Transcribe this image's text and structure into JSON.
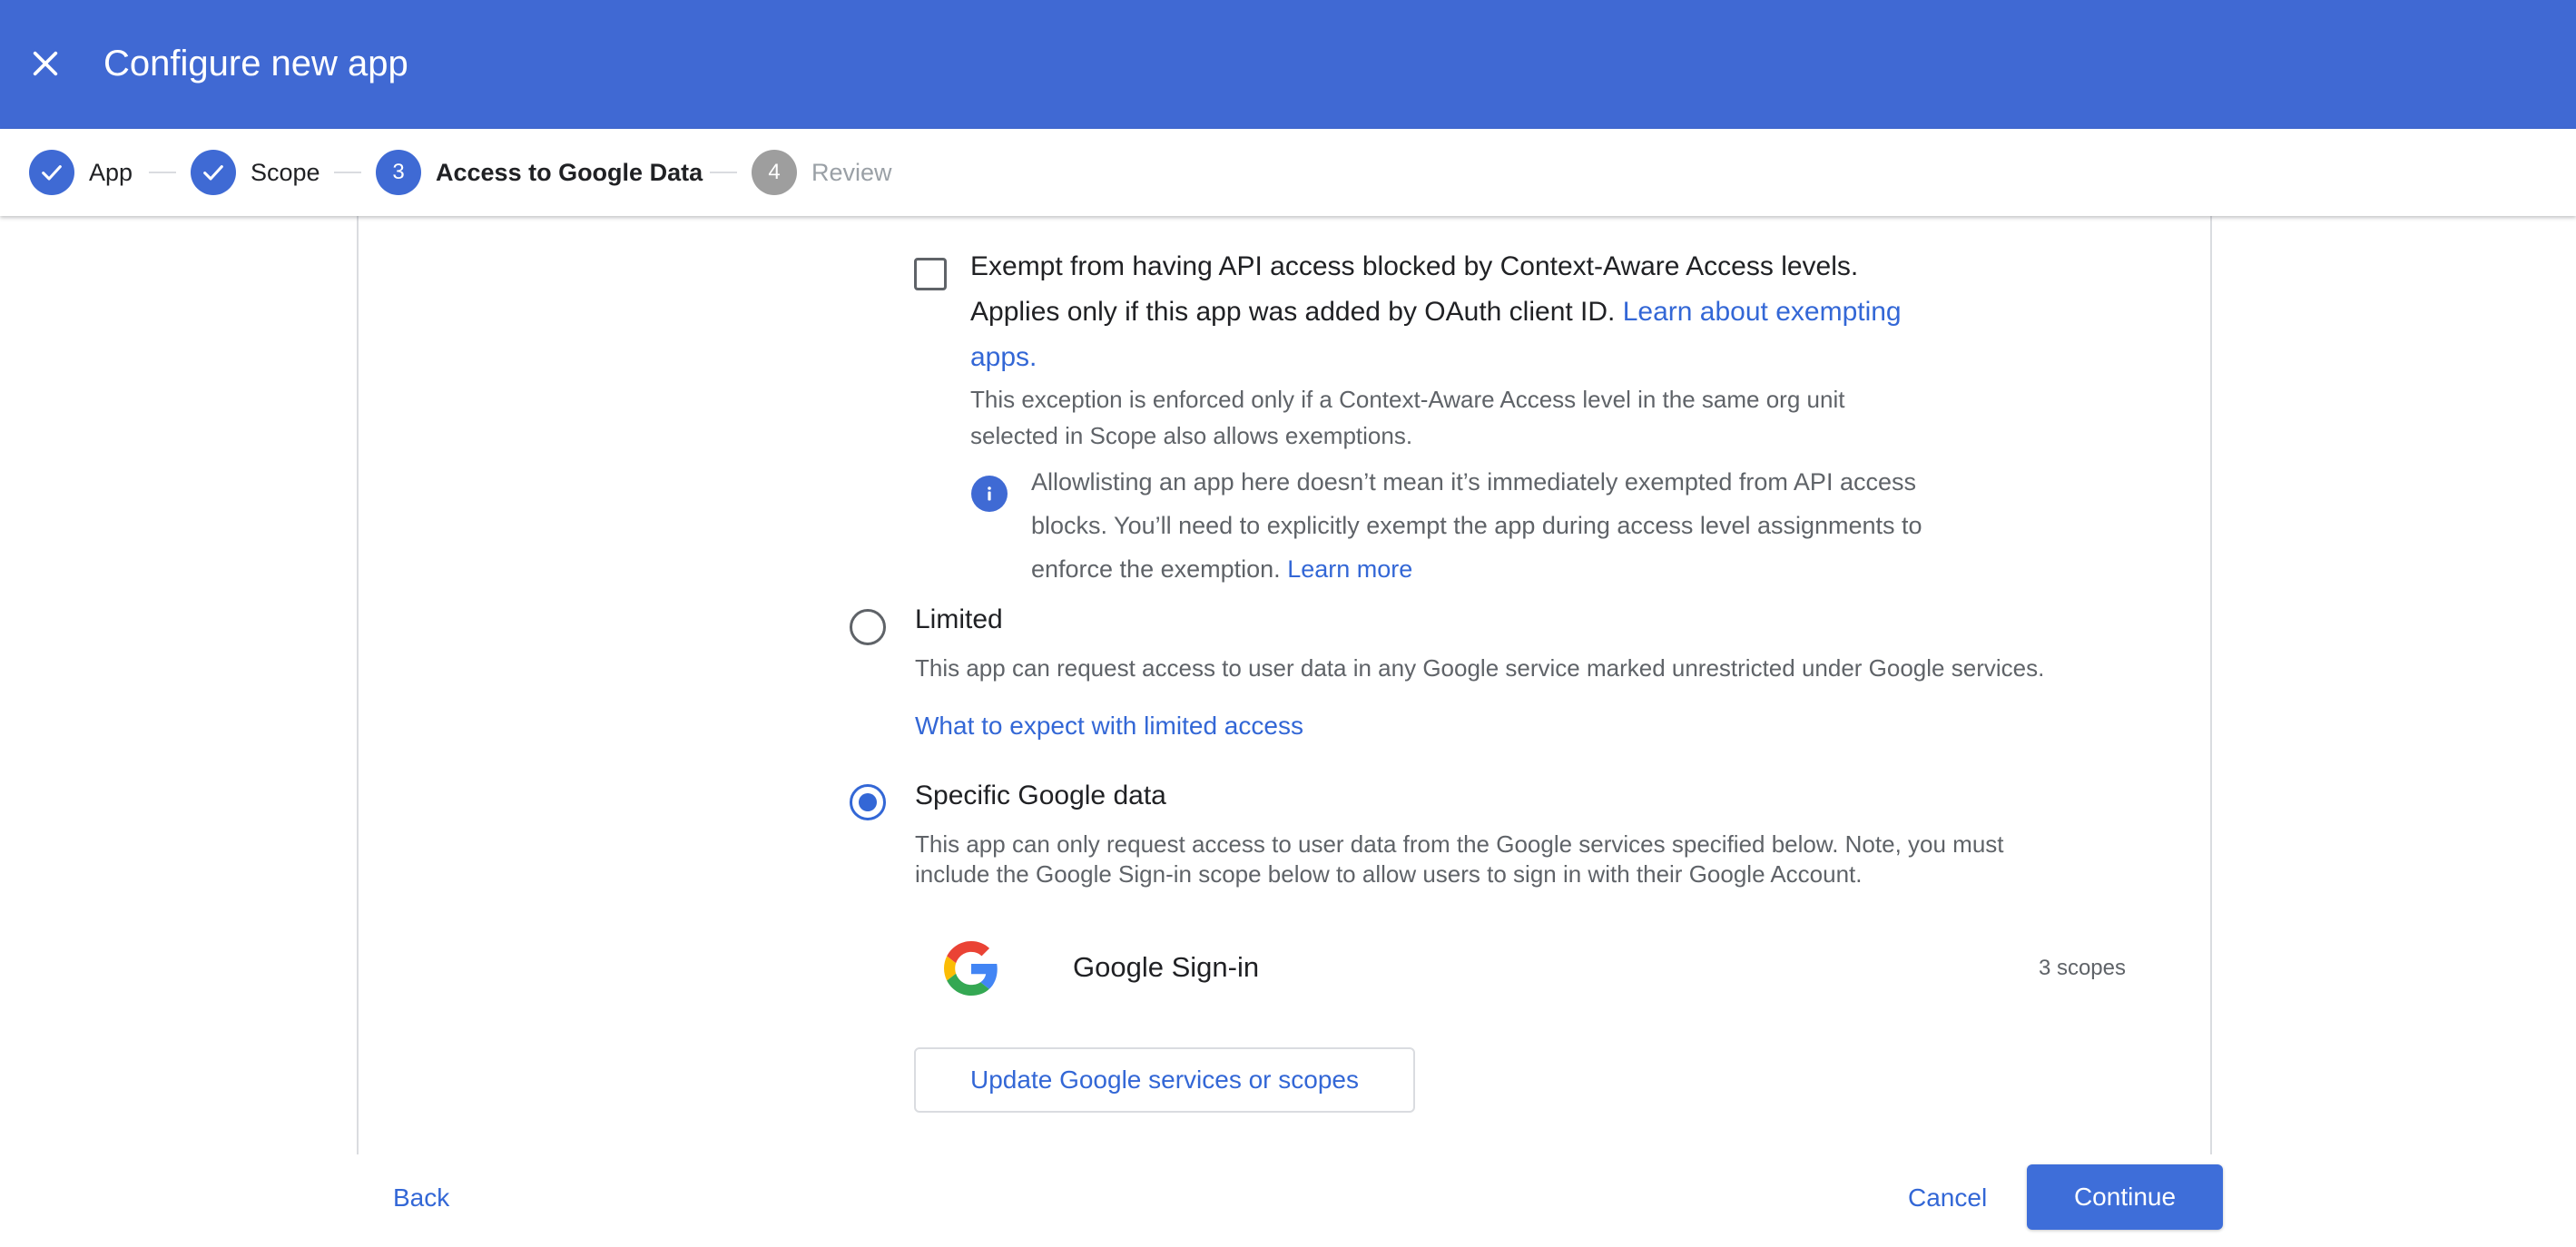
{
  "header": {
    "title": "Configure new app",
    "close_icon": "close-icon"
  },
  "stepper": {
    "steps": [
      {
        "label": "App",
        "state": "completed",
        "marker": "check-icon"
      },
      {
        "label": "Scope",
        "state": "completed",
        "marker": "check-icon"
      },
      {
        "label": "Access to Google Data",
        "state": "current",
        "number": "3"
      },
      {
        "label": "Review",
        "state": "upcoming",
        "number": "4"
      }
    ]
  },
  "exempt": {
    "checkbox_checked": false,
    "title": "Exempt from having API access blocked by Context-Aware Access levels.",
    "desc_line2_prefix": "Applies only if this app was added by OAuth client ID.",
    "desc_link_part1": "Learn about exempting",
    "desc_link_part2": "apps.",
    "note_line1": "This exception is enforced only if a Context-Aware Access level in the same org unit",
    "note_line2": "selected in Scope also allows exemptions.",
    "info": {
      "icon": "info-icon",
      "line1": "Allowlisting an app here doesn’t mean it’s immediately exempted from API access",
      "line2": "blocks. You’ll need to explicitly exempt the app during access level assignments to",
      "line3": "enforce the exemption.",
      "link": "Learn more"
    }
  },
  "limited": {
    "selected": false,
    "title": "Limited",
    "description": "This app can request access to user data in any Google service marked unrestricted under Google services.",
    "link": "What to expect with limited access"
  },
  "specific": {
    "selected": true,
    "title": "Specific Google data",
    "desc_line1": "This app can only request access to user data from the Google services specified below. Note, you must",
    "desc_line2": "include the Google Sign-in scope below to allow users to sign in with their Google Account.",
    "service": {
      "icon": "google-g-logo-icon",
      "name": "Google Sign-in",
      "scopes": "3 scopes"
    },
    "update_button": "Update Google services or scopes"
  },
  "footer": {
    "back": "Back",
    "cancel": "Cancel",
    "continue": "Continue"
  },
  "colors": {
    "header_bg": "#4069d3",
    "accent": "#3367d6",
    "step_inactive": "#9e9e9e",
    "primary_button": "#3e6ed9"
  }
}
